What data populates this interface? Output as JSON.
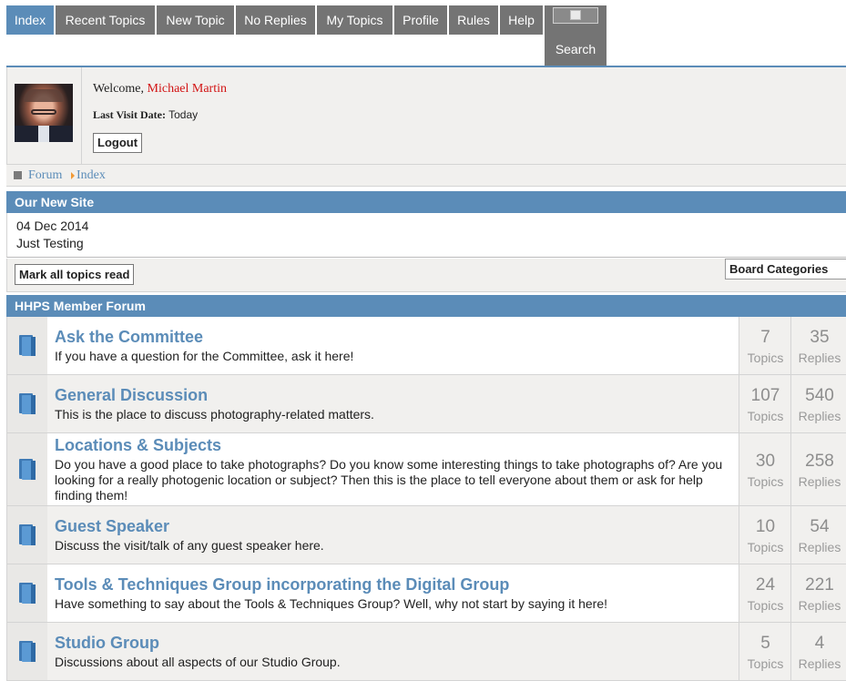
{
  "tabs": [
    {
      "label": "Index",
      "active": true
    },
    {
      "label": "Recent Topics"
    },
    {
      "label": "New Topic"
    },
    {
      "label": "No Replies"
    },
    {
      "label": "My Topics"
    },
    {
      "label": "Profile"
    },
    {
      "label": "Rules"
    },
    {
      "label": "Help"
    },
    {
      "label": "Search",
      "icon": "broken-image-icon"
    }
  ],
  "user": {
    "welcome_prefix": "Welcome,",
    "name": "Michael Martin",
    "last_visit_label": "Last Visit Date:",
    "last_visit_value": "Today",
    "logout_label": "Logout"
  },
  "breadcrumb": {
    "forum": "Forum",
    "index": "Index"
  },
  "news": {
    "header": "Our New Site",
    "date": "04 Dec 2014",
    "text": "Just Testing"
  },
  "actions": {
    "mark_read_label": "Mark all topics read",
    "board_categories": "Board Categories"
  },
  "forum_section": {
    "header": "HHPS Member Forum",
    "topics_label": "Topics",
    "replies_label": "Replies",
    "forums": [
      {
        "title": "Ask the Committee",
        "description": "If you have a question for the Committee, ask it here!",
        "topics": "7",
        "replies": "35"
      },
      {
        "title": "General Discussion",
        "description": "This is the place to discuss photography-related matters.",
        "topics": "107",
        "replies": "540"
      },
      {
        "title": "Locations & Subjects",
        "description": "Do you have a good place to take photographs? Do you know some interesting things to take photographs of? Are you looking for a really photogenic location or subject? Then this is the place to tell everyone about them or ask for help finding them!",
        "topics": "30",
        "replies": "258"
      },
      {
        "title": "Guest Speaker",
        "description": "Discuss the visit/talk of any guest speaker here.",
        "topics": "10",
        "replies": "54"
      },
      {
        "title": "Tools & Techniques Group incorporating the Digital Group",
        "description": "Have something to say about the Tools & Techniques Group? Well, why not start by saying it here!",
        "topics": "24",
        "replies": "221"
      },
      {
        "title": "Studio Group",
        "description": "Discussions about all aspects of our Studio Group.",
        "topics": "5",
        "replies": "4"
      }
    ]
  },
  "colors": {
    "accent": "#5b8cb8",
    "tab": "#747474",
    "user_name": "#d21414",
    "panel": "#f1f0ee"
  }
}
